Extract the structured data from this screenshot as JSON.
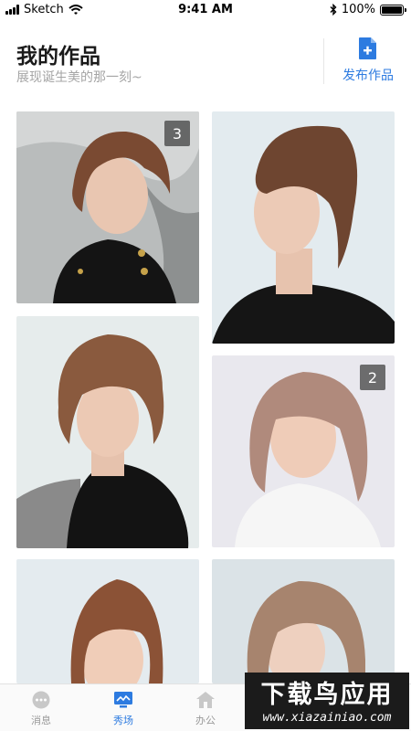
{
  "status_bar": {
    "carrier": "Sketch",
    "time": "9:41 AM",
    "battery": "100%",
    "battery_level": 1.0
  },
  "header": {
    "title": "我的作品",
    "subtitle": "展现诞生美的那一刻~",
    "publish_label": "发布作品"
  },
  "colors": {
    "accent": "#2d7be0",
    "subtitle": "#a5a5a5"
  },
  "gallery": {
    "items": [
      {
        "badge": "3"
      },
      {
        "badge": ""
      },
      {
        "badge": ""
      },
      {
        "badge": "2"
      },
      {
        "badge": ""
      },
      {
        "badge": ""
      }
    ]
  },
  "tab_bar": {
    "tabs": [
      {
        "label": "消息",
        "icon": "chat-bubble-icon"
      },
      {
        "label": "秀场",
        "icon": "showcase-icon"
      },
      {
        "label": "办公",
        "icon": "home-icon"
      },
      {
        "label": "",
        "icon": ""
      },
      {
        "label": "",
        "icon": ""
      }
    ],
    "active_index": 1
  },
  "watermark": {
    "title": "下载鸟应用",
    "url": "www.xiazainiao.com"
  }
}
